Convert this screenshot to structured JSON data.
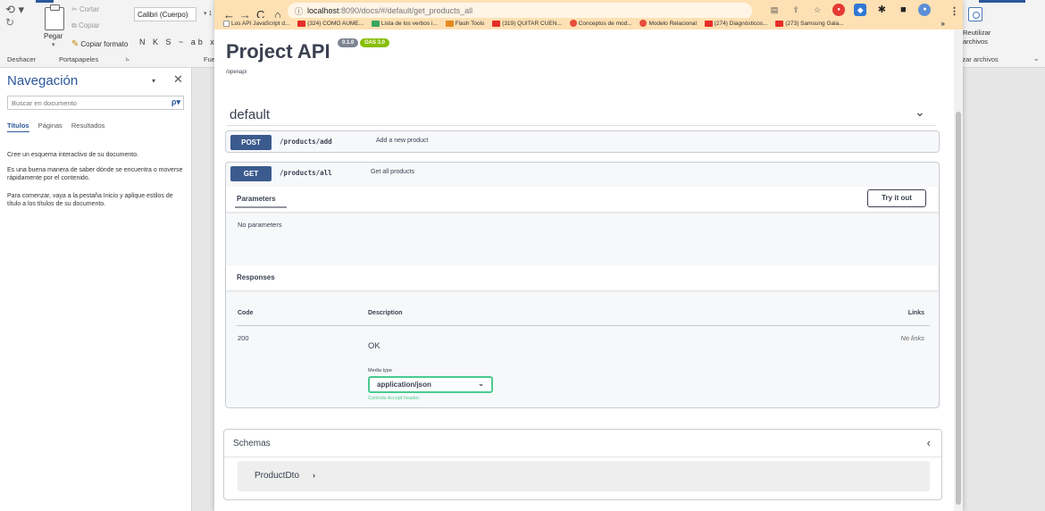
{
  "word": {
    "ribbon": {
      "undo_group_label": "Deshacer",
      "clipboard_group_label": "Portapapeles",
      "paste_label": "Pegar",
      "cut_label": "Cortar",
      "copy_label": "Copiar",
      "format_painter_label": "Copiar formato",
      "font_name": "Calibri (Cuerpo)",
      "font_formatting": "N K S ~ ab x",
      "font_group_label": "Fue",
      "reuse_label_1": "Reutilizar",
      "reuse_label_2": "archivos",
      "reuse_group_label": "lizar archivos"
    },
    "nav_pane": {
      "title": "Navegación",
      "search_placeholder": "Buscar en documento",
      "tabs": [
        {
          "label": "Títulos"
        },
        {
          "label": "Páginas"
        },
        {
          "label": "Resultados"
        }
      ],
      "text_1": "Cree un esquema interactivo de su documento.",
      "text_2": "Es una buena manera de saber dónde se encuentra o moverse rápidamente por el contenido.",
      "text_3": "Para comenzar, vaya a la pestaña Inicio y aplique estilos de título a los títulos de su documento."
    }
  },
  "browser": {
    "url_host": "localhost",
    "url_path": ":8090/docs/#/default/get_products_all",
    "bookmarks": [
      {
        "label": "Los API JavaScript d...",
        "icon": "doc"
      },
      {
        "label": "(324) COMO AUME...",
        "icon": "youtube"
      },
      {
        "label": "Lista de los verbos i...",
        "icon": "green"
      },
      {
        "label": "Flash Tools",
        "icon": "flash"
      },
      {
        "label": "(319) QUITAR CUEN...",
        "icon": "youtube"
      },
      {
        "label": "Conceptos de mod...",
        "icon": "chrome-red"
      },
      {
        "label": "Modelo Relacional",
        "icon": "chrome-red"
      },
      {
        "label": "(274) Diagnósticos...",
        "icon": "youtube"
      },
      {
        "label": "(273) Samsung Gala...",
        "icon": "youtube"
      }
    ],
    "bookmarks_more": "»"
  },
  "swagger": {
    "title": "Project API",
    "version_badge": "0.1.0",
    "oas_badge": "OAS 3.0",
    "openapi_link": "/openapi",
    "tag": "default",
    "operations": [
      {
        "method": "POST",
        "path": "/products/add",
        "summary": "Add a new product"
      },
      {
        "method": "GET",
        "path": "/products/all",
        "summary": "Get all products"
      }
    ],
    "parameters_label": "Parameters",
    "try_it_out": "Try it out",
    "no_parameters": "No parameters",
    "responses_label": "Responses",
    "columns": {
      "code": "Code",
      "description": "Description",
      "links": "Links"
    },
    "response": {
      "code": "200",
      "description": "OK",
      "links": "No links"
    },
    "media_type_label": "Media type",
    "media_type_value": "application/json",
    "media_type_note": "Controls Accept header.",
    "schemas_title": "Schemas",
    "schema_model": "ProductDto"
  },
  "colors": {
    "get_method": "#3b5b8e",
    "post_method": "#3b5b8e",
    "select_border": "#49cc90",
    "browser_toolbar": "#fde0b3",
    "word_accent": "#2b579a"
  }
}
